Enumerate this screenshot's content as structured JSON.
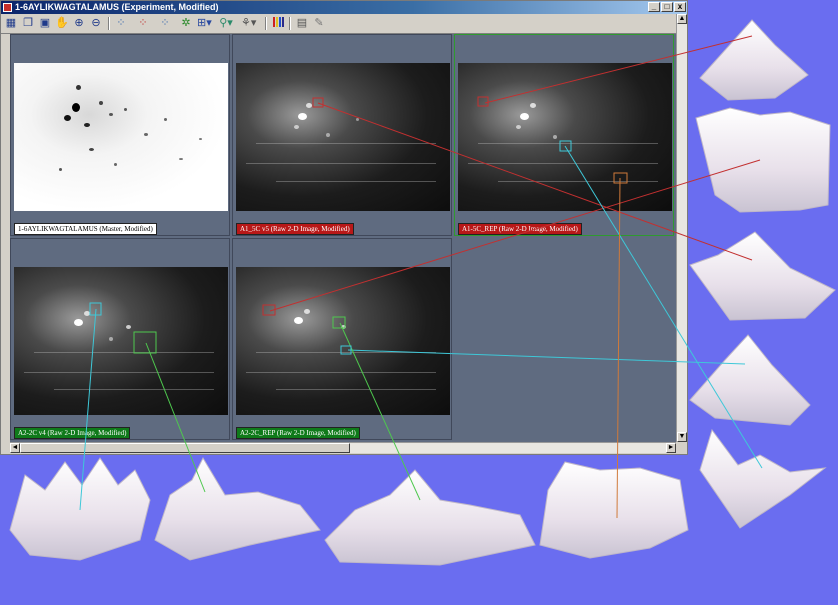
{
  "window": {
    "title": "1-6AYLIKWAGTALAMUS (Experiment, Modified)",
    "controls": {
      "minimize": "_",
      "maximize": "□",
      "close": "x"
    }
  },
  "toolbar": {
    "icons": [
      "grid-view-icon",
      "window-icon",
      "overview-icon",
      "hand-pan-icon",
      "zoom-in-icon",
      "zoom-out-icon",
      "spot-tool-icon",
      "spot-add-icon",
      "spot-edit-icon",
      "match-icon",
      "grid-icon",
      "link-icon",
      "landmark-icon",
      "color-bars-icon",
      "report-icon",
      "export-icon"
    ]
  },
  "panels": [
    {
      "label": "1-6AYLIKWAGTALAMUS (Master, Modified)",
      "style": "white"
    },
    {
      "label": "A1_5C v5 (Raw 2-D Image, Modified)",
      "style": "red"
    },
    {
      "label": "A1-5C_REP (Raw 2-D Image, Modified)",
      "style": "red"
    },
    {
      "label": "A2-2C v4 (Raw 2-D Image, Modified)",
      "style": "green"
    },
    {
      "label": "A2-2C_REP (Raw 2-D Image, Modified)",
      "style": "green"
    }
  ],
  "scrollbars": {
    "up": "▲",
    "down": "▼",
    "left": "◄",
    "right": "►"
  },
  "colors": {
    "background": "#6a6df0",
    "red_link": "#c23030",
    "cyan_link": "#3ec8d8",
    "orange_link": "#d07a3a",
    "green_link": "#4ec84e",
    "surface": "#f0eaf2"
  }
}
